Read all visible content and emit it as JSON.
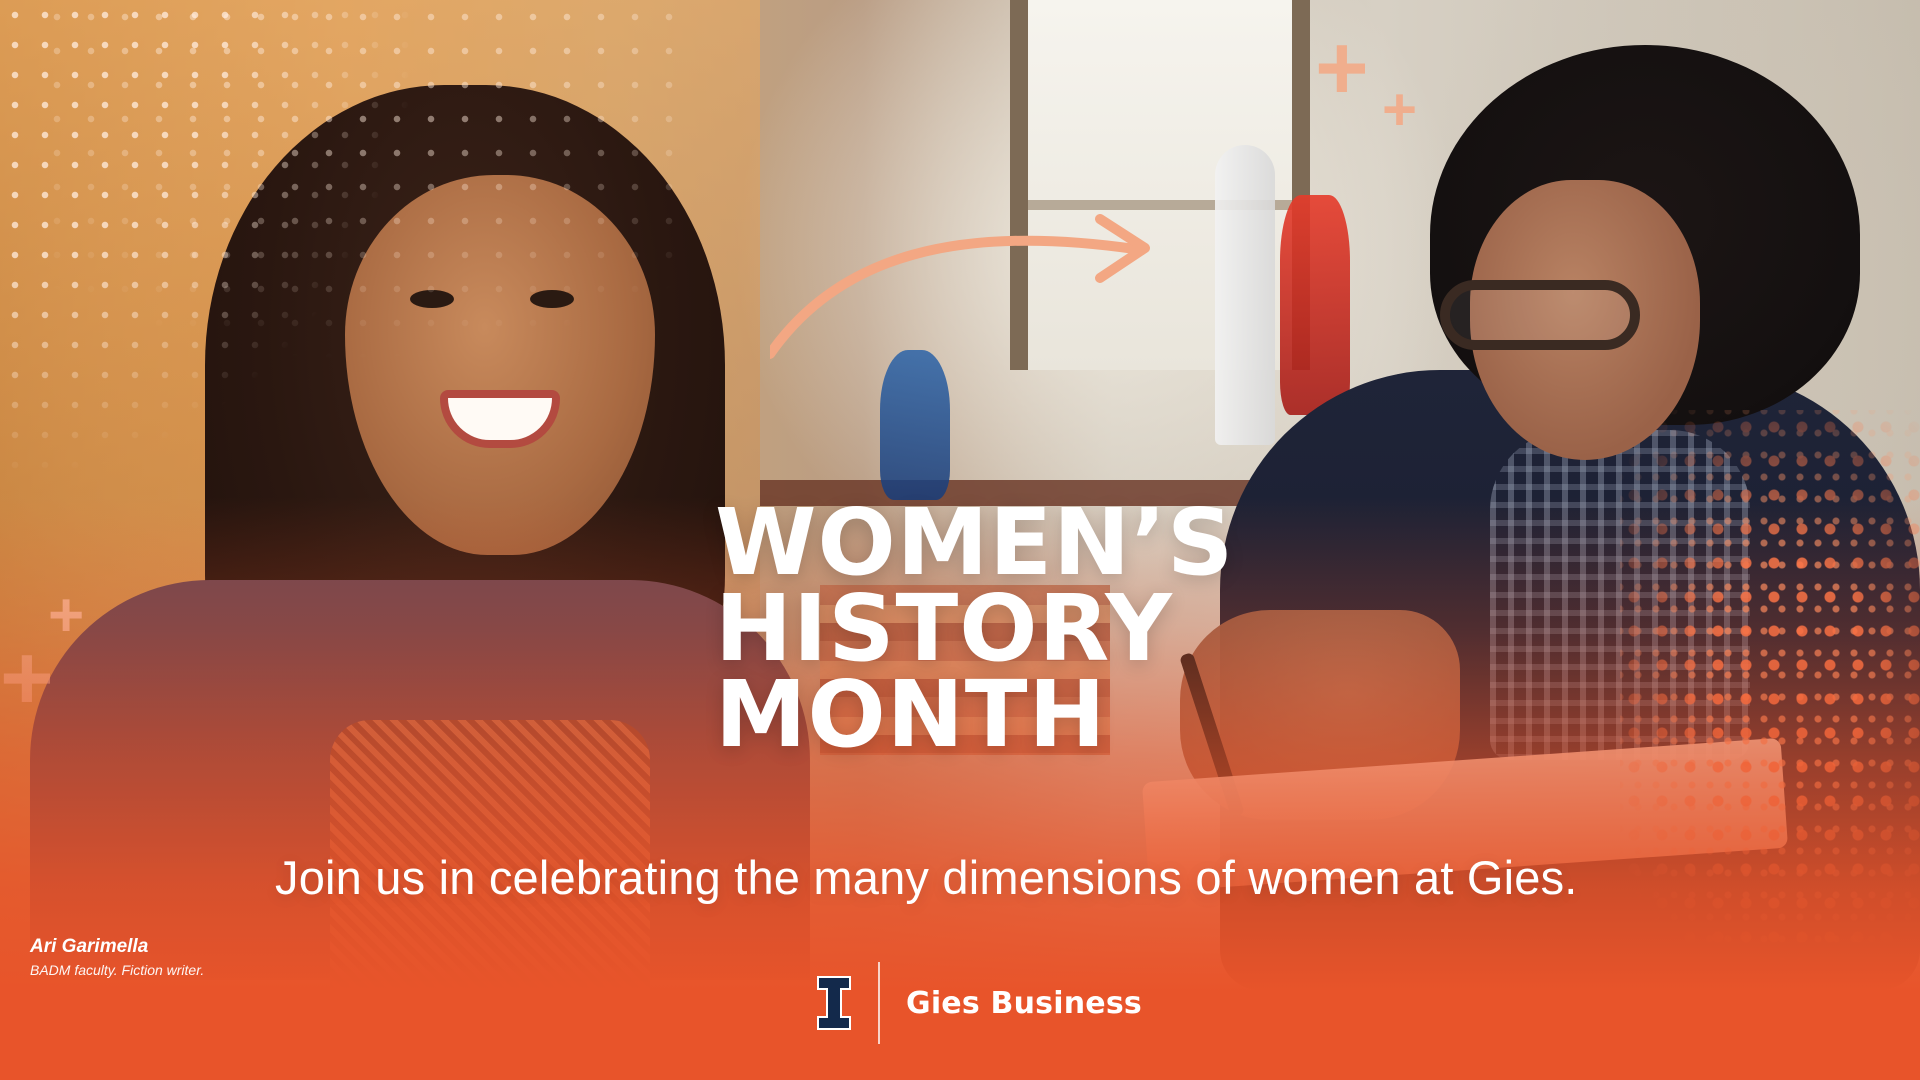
{
  "banner": {
    "headline": [
      "WOMEN’S",
      "HISTORY",
      "MONTH"
    ],
    "subheadline": "Join us in celebrating the many dimensions of women at Gies.",
    "caption": {
      "name": "Ari Garimella",
      "role": "BADM faculty. Fiction writer."
    },
    "brand": {
      "name": "Gies Business",
      "icon": "illinois-block-i-logo"
    },
    "colors": {
      "accent_orange": "#E8532A",
      "illinois_navy": "#13294B",
      "text_white": "#FFFFFF"
    }
  }
}
